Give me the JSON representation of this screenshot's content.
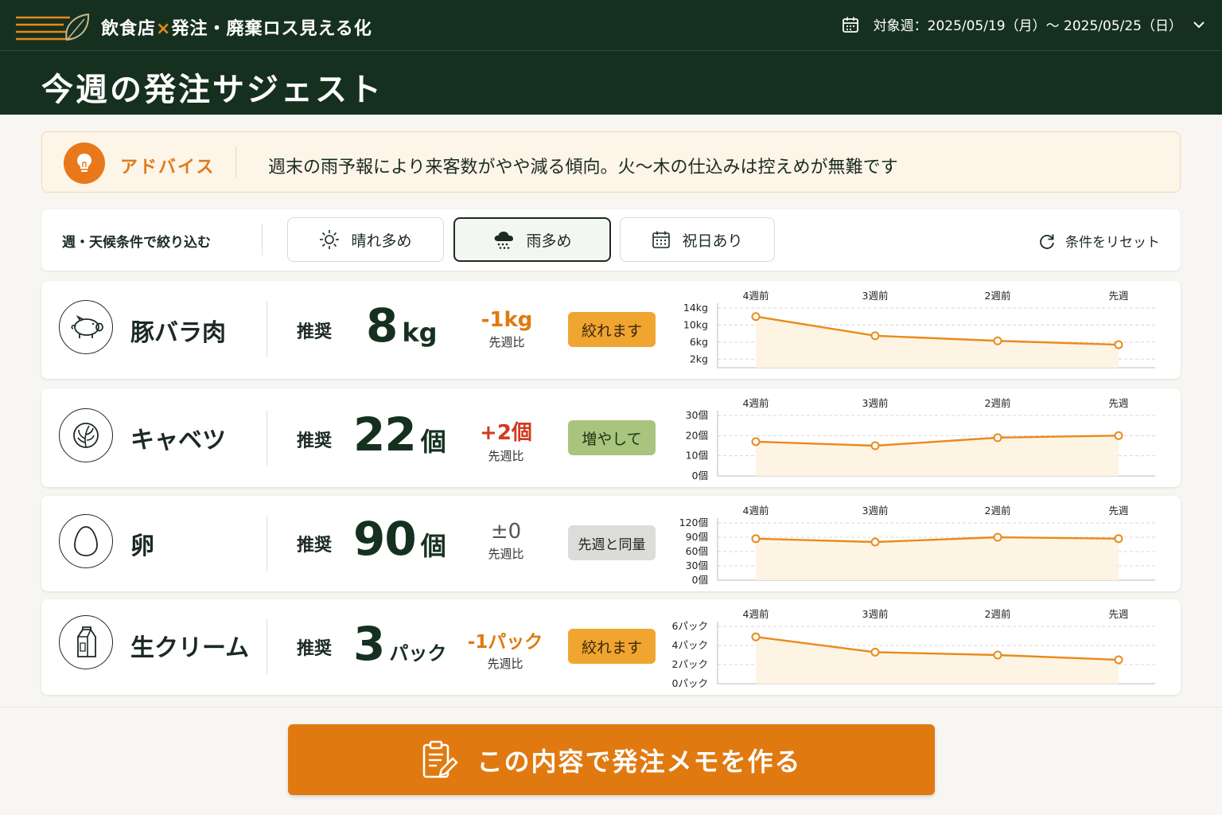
{
  "header": {
    "app_title_a": "飲食店",
    "app_title_x": "×",
    "app_title_b": "発注・廃棄ロス見える化",
    "week_label": "対象週：2025/05/19（月）〜 2025/05/25（日）"
  },
  "page": {
    "title": "今週の発注サジェスト"
  },
  "advice": {
    "label": "アドバイス",
    "text": "週末の雨予報により来客数がやや減る傾向。火〜木の仕込みは控えめが無難です"
  },
  "filters": {
    "label": "週・天候条件で絞り込む",
    "chips": [
      {
        "label": "晴れ多め",
        "icon": "sun-icon",
        "active": false
      },
      {
        "label": "雨多め",
        "icon": "rain-cloud-icon",
        "active": true
      },
      {
        "label": "祝日あり",
        "icon": "calendar-icon",
        "active": false
      }
    ],
    "reset_label": "条件をリセット"
  },
  "items": [
    {
      "name": "豚バラ肉",
      "icon": "pig-icon",
      "rec_label": "推奨",
      "qty": "8",
      "unit": "kg",
      "delta": "-1kg",
      "delta_label": "先週比",
      "delta_color": "#e07a10",
      "badge": "絞れます",
      "badge_bg": "#f0a531",
      "badge_fg": "#3a2608",
      "chart": {
        "weeks": [
          "4週前",
          "3週前",
          "2週前",
          "先週"
        ],
        "ticks": [
          "14kg",
          "10kg",
          "6kg",
          "2kg"
        ],
        "tick_values": [
          14,
          10,
          6,
          2
        ],
        "ymin": 0,
        "ymax": 14,
        "values": [
          12,
          7.5,
          6.3,
          5.4
        ]
      }
    },
    {
      "name": "キャベツ",
      "icon": "cabbage-icon",
      "rec_label": "推奨",
      "qty": "22",
      "unit": "個",
      "delta": "+2個",
      "delta_label": "先週比",
      "delta_color": "#d23a1e",
      "badge": "増やして",
      "badge_bg": "#a9c47f",
      "badge_fg": "#1f3310",
      "chart": {
        "weeks": [
          "4週前",
          "3週前",
          "2週前",
          "先週"
        ],
        "ticks": [
          "30個",
          "20個",
          "10個",
          "0個"
        ],
        "tick_values": [
          30,
          20,
          10,
          0
        ],
        "ymin": 0,
        "ymax": 30,
        "values": [
          17,
          15,
          19,
          20
        ]
      }
    },
    {
      "name": "卵",
      "icon": "egg-icon",
      "rec_label": "推奨",
      "qty": "90",
      "unit": "個",
      "delta": "±0",
      "delta_label": "先週比",
      "delta_color": "#555555",
      "badge": "先週と同量",
      "badge_bg": "#dcdcda",
      "badge_fg": "#222222",
      "chart": {
        "weeks": [
          "4週前",
          "3週前",
          "2週前",
          "先週"
        ],
        "ticks": [
          "120個",
          "90個",
          "60個",
          "30個",
          "0個"
        ],
        "tick_values": [
          120,
          90,
          60,
          30,
          0
        ],
        "ymin": 0,
        "ymax": 120,
        "values": [
          87,
          80,
          90,
          87
        ]
      }
    },
    {
      "name": "生クリーム",
      "icon": "milk-carton-icon",
      "rec_label": "推奨",
      "qty": "3",
      "unit": "パック",
      "delta": "-1パック",
      "delta_label": "先週比",
      "delta_color": "#e07a10",
      "badge": "絞れます",
      "badge_bg": "#f0a531",
      "badge_fg": "#3a2608",
      "chart": {
        "weeks": [
          "4週前",
          "3週前",
          "2週前",
          "先週"
        ],
        "ticks": [
          "6パック",
          "4パック",
          "2パック",
          "0パック"
        ],
        "tick_values": [
          6,
          4,
          2,
          0
        ],
        "ymin": 0,
        "ymax": 6,
        "values": [
          4.9,
          3.3,
          3.0,
          2.5
        ]
      }
    }
  ],
  "cta": {
    "label": "この内容で発注メモを作る"
  },
  "colors": {
    "accent": "#e07a10",
    "header_bg": "#163020",
    "line": "#ea8a1c",
    "area": "#fdf3e0"
  }
}
